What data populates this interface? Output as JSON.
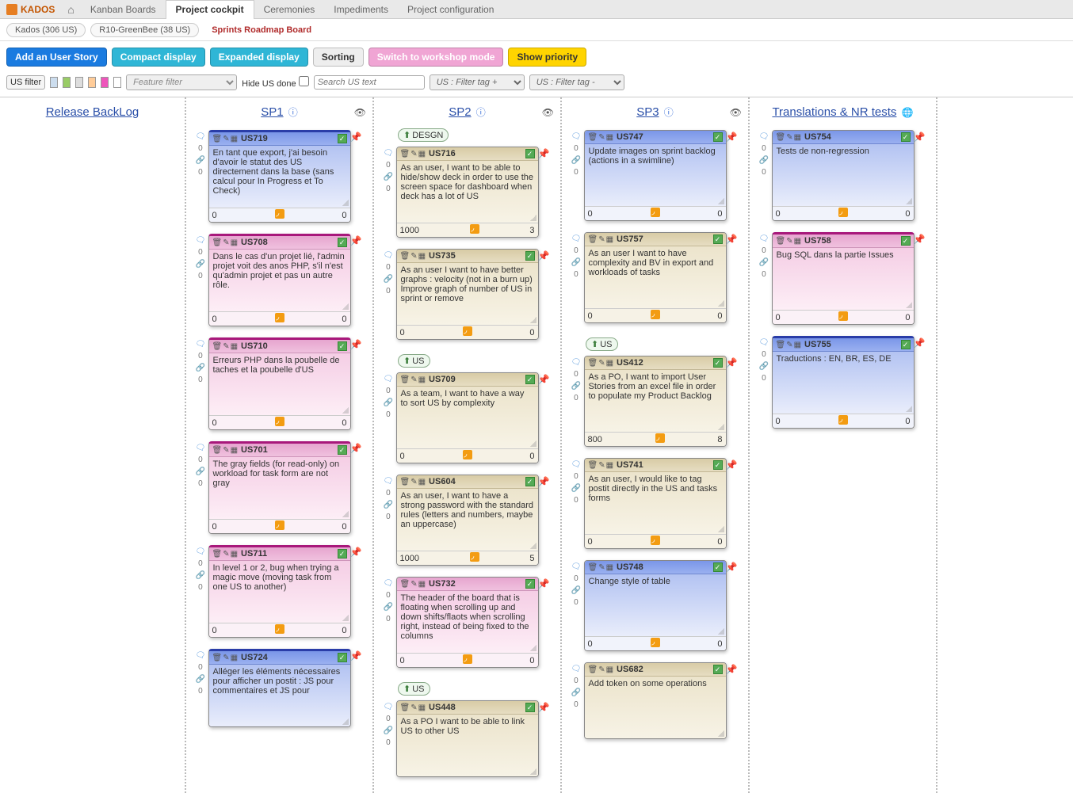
{
  "app": {
    "name": "KADOS"
  },
  "nav": {
    "tabs": [
      "Kanban Boards",
      "Project cockpit",
      "Ceremonies",
      "Impediments",
      "Project configuration"
    ],
    "active": 1
  },
  "breadcrumb": {
    "items": [
      "Kados (306 US)",
      "R10-GreenBee (38 US)"
    ],
    "current": "Sprints Roadmap Board"
  },
  "toolbar": {
    "add": "Add an User Story",
    "compact": "Compact display",
    "expanded": "Expanded display",
    "sorting": "Sorting",
    "workshop": "Switch to workshop mode",
    "priority": "Show priority"
  },
  "filters": {
    "us_filter": "US filter",
    "feature_placeholder": "Feature filter",
    "hide_done": "Hide US done",
    "search_placeholder": "Search US text",
    "tag1": "US : Filter tag + ",
    "tag2": "US : Filter tag - "
  },
  "columns": [
    {
      "title": "Release BackLog",
      "eye": false,
      "info": false,
      "cards": []
    },
    {
      "title": "SP1",
      "eye": true,
      "info": true,
      "cards": [
        {
          "id": "US719",
          "theme": "blue",
          "border": true,
          "text": "En tant que export, j'ai besoin d'avoir le statut des US directement dans la base (sans calcul pour In Progress et To Check)",
          "left": "0",
          "right": "0"
        },
        {
          "id": "US708",
          "theme": "pink",
          "border": true,
          "text": "Dans le cas d'un projet lié, l'admin projet voit des anos PHP, s'il n'est qu'admin projet et pas un autre rôle.",
          "left": "0",
          "right": "0"
        },
        {
          "id": "US710",
          "theme": "pink",
          "border": true,
          "text": "Erreurs PHP dans la poubelle de taches et la poubelle d'US",
          "left": "0",
          "right": "0"
        },
        {
          "id": "US701",
          "theme": "pink",
          "border": true,
          "text": "The gray fields (for read-only) on workload for task form are not gray",
          "left": "0",
          "right": "0"
        },
        {
          "id": "US711",
          "theme": "pink",
          "border": true,
          "text": "In level 1 or 2, bug when trying a magic move (moving task from one US to another)",
          "left": "0",
          "right": "0"
        },
        {
          "id": "US724",
          "theme": "blue",
          "border": true,
          "text": "Alléger les éléments nécessaires pour afficher un postit : JS pour commentaires et JS pour",
          "left": "",
          "right": ""
        }
      ]
    },
    {
      "title": "SP2",
      "eye": true,
      "info": true,
      "tags_before": [
        {
          "before_idx": 0,
          "label": "DESGN"
        },
        {
          "before_idx": 2,
          "label": "US"
        },
        {
          "before_idx": 5,
          "label": "US"
        }
      ],
      "cards": [
        {
          "id": "US716",
          "theme": "tan",
          "text": "As an user, I want to be able to hide/show deck in order to use the screen space for dashboard when deck has a lot of US",
          "left": "1000",
          "right": "3"
        },
        {
          "id": "US735",
          "theme": "tan",
          "text": "As an user I want to have better graphs : velocity (not in a burn up) Improve graph of number of US in sprint or remove",
          "left": "0",
          "right": "0"
        },
        {
          "id": "US709",
          "theme": "tan",
          "text": "As a team, I want to have a way to sort US by complexity",
          "left": "0",
          "right": "0"
        },
        {
          "id": "US604",
          "theme": "tan",
          "text": "As an user, I want to have a strong password with the standard rules (letters and numbers, maybe an uppercase)",
          "left": "1000",
          "right": "5"
        },
        {
          "id": "US732",
          "theme": "pink",
          "text": "The header of the board that is floating when scrolling up and down shifts/flaots when scrolling right, instead of being fixed to the columns",
          "left": "0",
          "right": "0"
        },
        {
          "id": "US448",
          "theme": "tan",
          "text": "As a PO I want to be able to link US to other US",
          "left": "",
          "right": ""
        }
      ]
    },
    {
      "title": "SP3",
      "eye": true,
      "info": true,
      "tags_before": [
        {
          "before_idx": 2,
          "label": "US"
        }
      ],
      "cards": [
        {
          "id": "US747",
          "theme": "blue",
          "text": "Update images on sprint backlog (actions in a swimline)",
          "left": "0",
          "right": "0"
        },
        {
          "id": "US757",
          "theme": "tan",
          "text": "As an user I want to have complexity and BV in export and workloads of tasks",
          "left": "0",
          "right": "0"
        },
        {
          "id": "US412",
          "theme": "tan",
          "text": "As a PO, I want to import User Stories from an excel file in order to populate my Product Backlog",
          "left": "800",
          "right": "8"
        },
        {
          "id": "US741",
          "theme": "tan",
          "text": "As an user, I would like to tag postit directly in the US and tasks forms",
          "left": "0",
          "right": "0"
        },
        {
          "id": "US748",
          "theme": "blue",
          "text": "Change style of table",
          "left": "0",
          "right": "0"
        },
        {
          "id": "US682",
          "theme": "tan",
          "text": "Add token on some operations",
          "left": "",
          "right": ""
        }
      ]
    },
    {
      "title": "Translations & NR tests",
      "eye": false,
      "globe": true,
      "cards": [
        {
          "id": "US754",
          "theme": "blue",
          "text": "Tests de non-regression",
          "left": "0",
          "right": "0"
        },
        {
          "id": "US758",
          "theme": "pink",
          "border": true,
          "text": "Bug SQL dans la partie Issues",
          "left": "0",
          "right": "0"
        },
        {
          "id": "US755",
          "theme": "blue",
          "border": true,
          "text": "Traductions : EN, BR, ES, DE",
          "left": "0",
          "right": "0"
        }
      ]
    }
  ]
}
